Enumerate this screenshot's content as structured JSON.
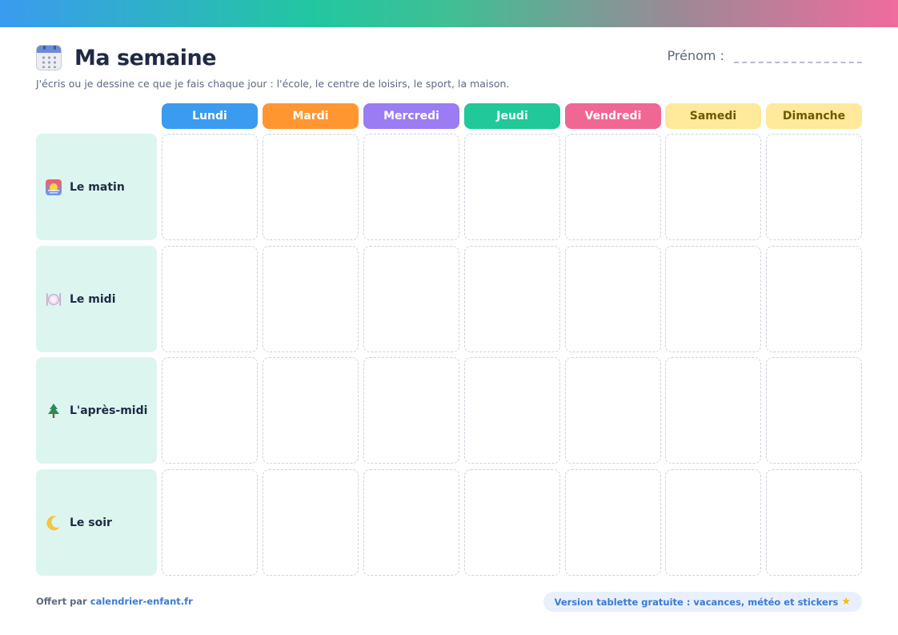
{
  "header": {
    "title": "Ma semaine",
    "subtitle": "J'écris ou je dessine ce que je fais chaque jour : l'école, le centre de loisirs, le sport, la maison.",
    "prenom_label": "Prénom :"
  },
  "days": [
    {
      "label": "Lundi",
      "color": "#3b9bef",
      "text_color": "#ffffff"
    },
    {
      "label": "Mardi",
      "color": "#ff9630",
      "text_color": "#ffffff"
    },
    {
      "label": "Mercredi",
      "color": "#9b7cf2",
      "text_color": "#ffffff"
    },
    {
      "label": "Jeudi",
      "color": "#20c997",
      "text_color": "#ffffff"
    },
    {
      "label": "Vendredi",
      "color": "#f06794",
      "text_color": "#ffffff"
    },
    {
      "label": "Samedi",
      "color": "#ffe99a",
      "text_color": "#6b5a00"
    },
    {
      "label": "Dimanche",
      "color": "#ffe99a",
      "text_color": "#6b5a00"
    }
  ],
  "rows": [
    {
      "label": "Le matin",
      "icon": "sunrise-icon"
    },
    {
      "label": "Le midi",
      "icon": "plate-icon"
    },
    {
      "label": "L'après-midi",
      "icon": "tree-icon"
    },
    {
      "label": "Le soir",
      "icon": "moon-icon"
    }
  ],
  "footer": {
    "offered_prefix": "Offert par",
    "offered_link": "calendrier-enfant.fr",
    "promo": "Version tablette gratuite : vacances, météo et stickers"
  },
  "colors": {
    "row_bg": "#dcf5ef",
    "accent": "#3a7bd5"
  }
}
